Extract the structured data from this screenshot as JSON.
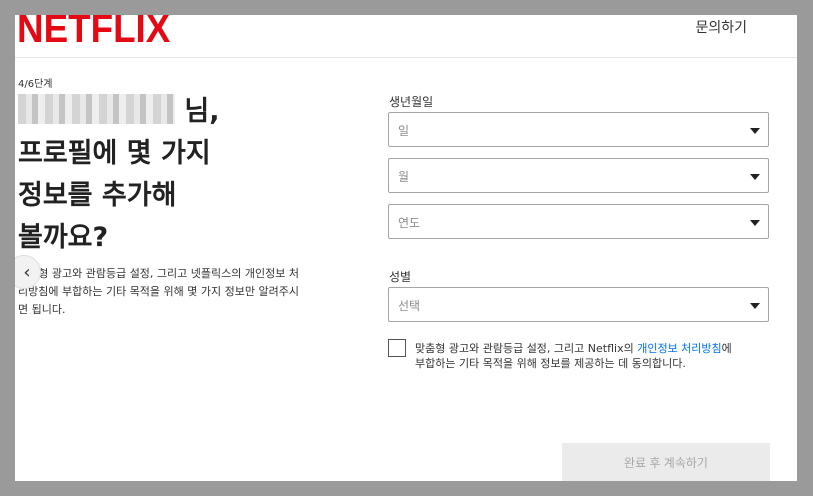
{
  "header": {
    "logo_text": "NETFLIX",
    "help_label": "문의하기"
  },
  "intro": {
    "step": "4/6단계",
    "title_line1_suffix": "님,",
    "title_line2": "프로필에 몇 가지",
    "title_line3": "정보를 추가해",
    "title_line4": "볼까요?",
    "description": "맞춤형 광고와 관람등급 설정, 그리고 넷플릭스의 개인정보 처리방침에 부합하는 기타 목적을 위해 몇 가지 정보만 알려주시면 됩니다."
  },
  "birthdate": {
    "label": "생년월일",
    "day_placeholder": "일",
    "month_placeholder": "월",
    "year_placeholder": "연도"
  },
  "gender": {
    "label": "성별",
    "placeholder": "선택"
  },
  "consent": {
    "text_before": "맞춤형 광고와 관람등급 설정, 그리고 Netflix의 ",
    "link_text": "개인정보 처리방침",
    "text_after": "에 부합하는 기타 목적을 위해 정보를 제공하는 데 동의합니다."
  },
  "submit_label": "완료 후 계속하기",
  "colors": {
    "brand": "#e50914",
    "link": "#0071eb",
    "disabled_button_bg": "#ebebeb"
  }
}
